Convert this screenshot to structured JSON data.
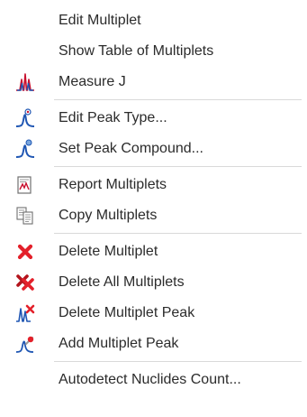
{
  "menu": {
    "items": [
      {
        "label": "Edit Multiplet",
        "icon": null
      },
      {
        "label": "Show Table of Multiplets",
        "icon": null
      },
      {
        "label": "Measure J",
        "icon": "measure-j-icon"
      },
      {
        "label": "Edit Peak Type...",
        "icon": "edit-peak-type-icon"
      },
      {
        "label": "Set Peak Compound...",
        "icon": "set-peak-compound-icon"
      },
      {
        "label": "Report Multiplets",
        "icon": "report-icon"
      },
      {
        "label": "Copy Multiplets",
        "icon": "copy-icon"
      },
      {
        "label": "Delete Multiplet",
        "icon": "delete-icon"
      },
      {
        "label": "Delete All Multiplets",
        "icon": "delete-all-icon"
      },
      {
        "label": "Delete Multiplet Peak",
        "icon": "delete-peak-icon"
      },
      {
        "label": "Add Multiplet Peak",
        "icon": "add-peak-icon"
      },
      {
        "label": "Autodetect Nuclides Count...",
        "icon": null
      }
    ]
  },
  "colors": {
    "text": "#2b2b2b",
    "separator": "#d9d9d9",
    "peak_blue": "#1f56b3",
    "peak_red": "#c8102e",
    "delete_red": "#e3202a"
  }
}
